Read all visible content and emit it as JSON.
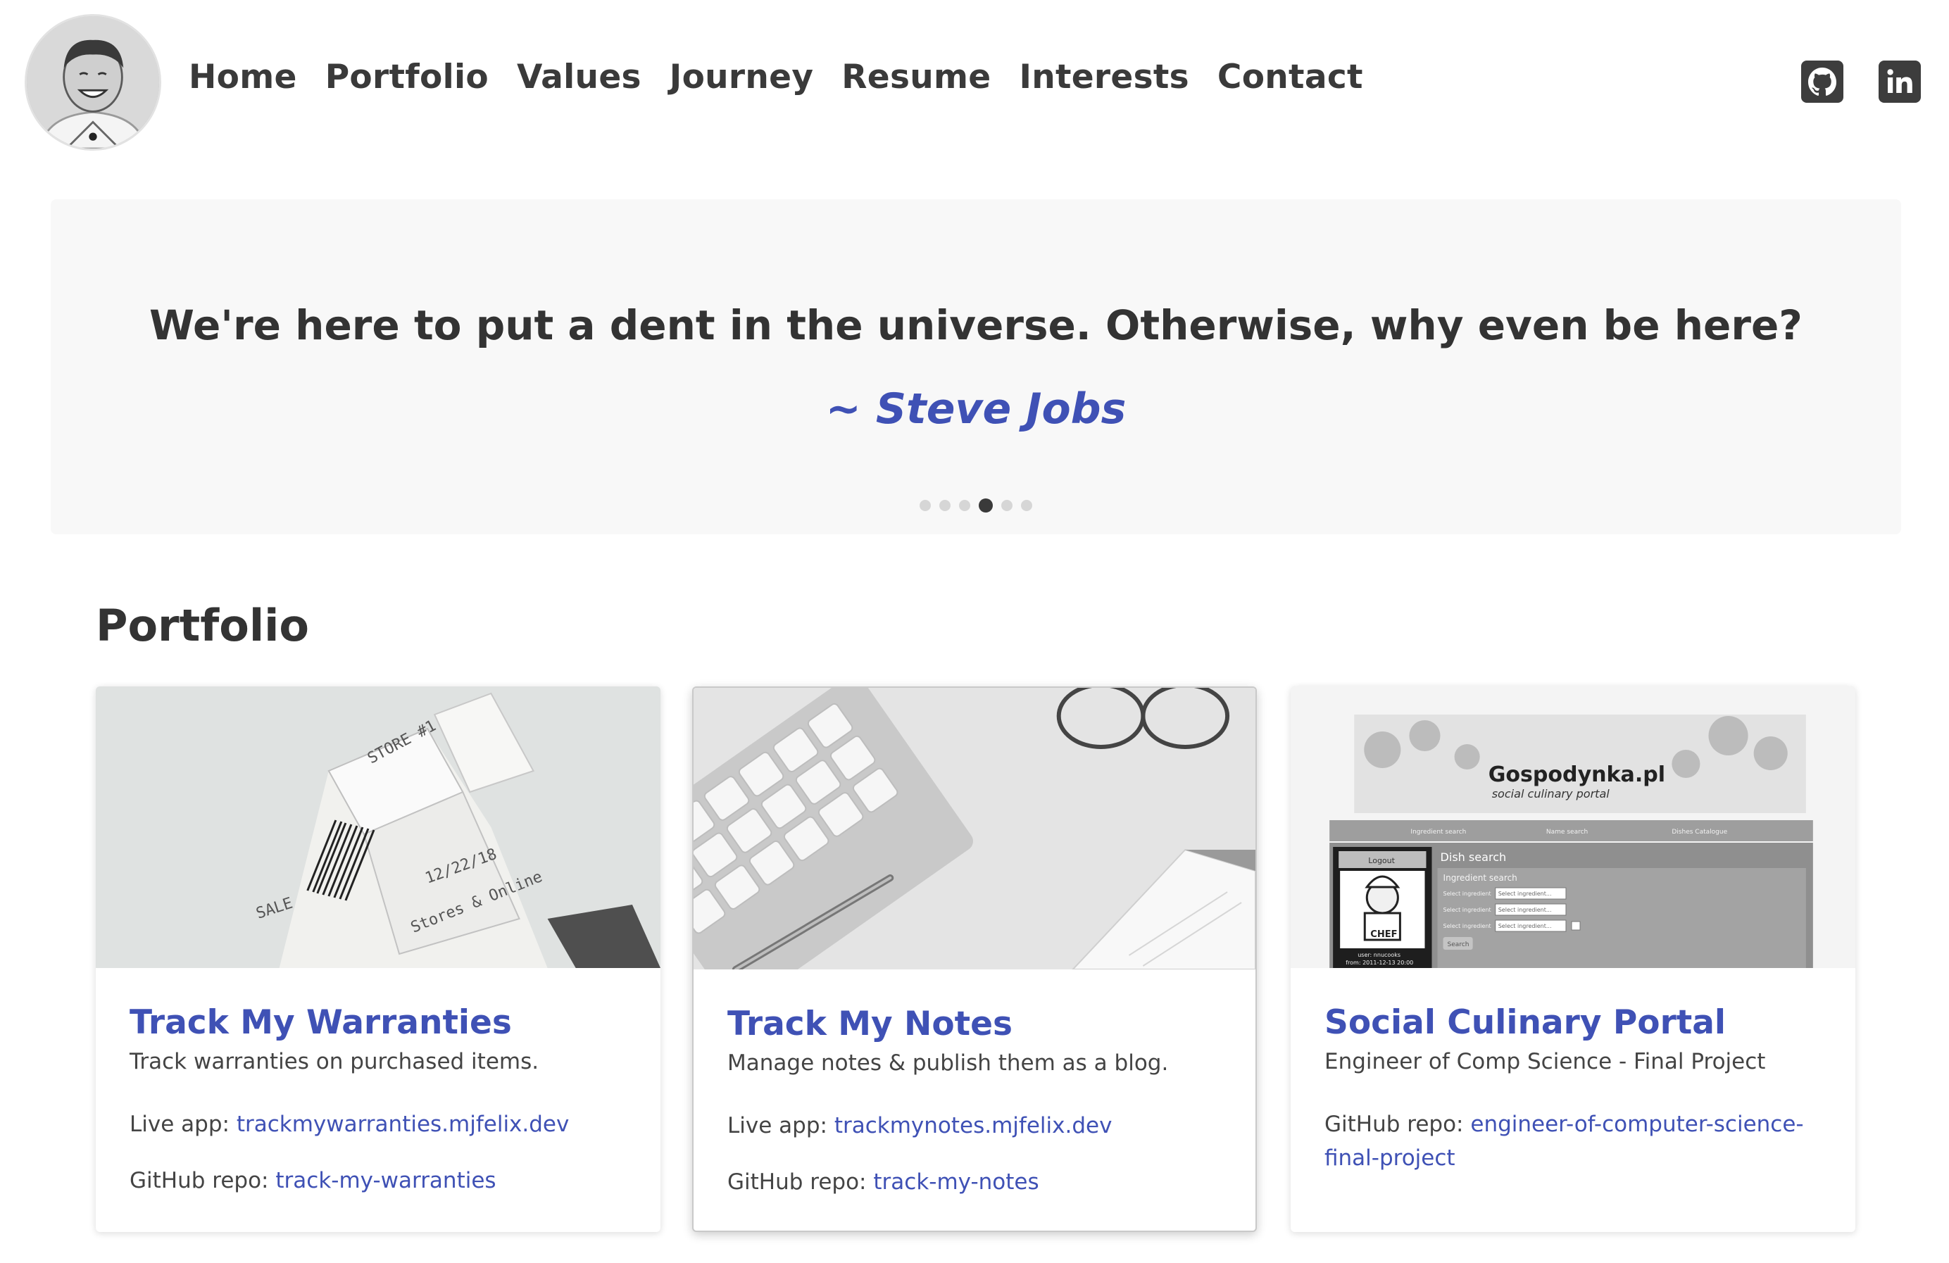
{
  "header": {
    "avatar_alt": "Profile photo",
    "nav": [
      "Home",
      "Portfolio",
      "Values",
      "Journey",
      "Resume",
      "Interests",
      "Contact"
    ],
    "social": [
      {
        "name": "github",
        "icon": "github-icon"
      },
      {
        "name": "linkedin",
        "icon": "linkedin-icon"
      }
    ]
  },
  "quote": {
    "text": "We're here to put a dent in the universe. Otherwise, why even be here?",
    "author": "~ Steve Jobs",
    "dots_total": 6,
    "active_index": 3
  },
  "portfolio": {
    "title": "Portfolio",
    "cards": [
      {
        "title": "Track My Warranties",
        "description": "Track warranties on purchased items.",
        "live_label": "Live app:",
        "live_link": "trackmywarranties.mjfelix.dev",
        "repo_label": "GitHub repo:",
        "repo_link": "track-my-warranties",
        "image_icon": "receipt-image"
      },
      {
        "title": "Track My Notes",
        "description": "Manage notes & publish them as a blog.",
        "live_label": "Live app:",
        "live_link": "trackmynotes.mjfelix.dev",
        "repo_label": "GitHub repo:",
        "repo_link": "track-my-notes",
        "image_icon": "keyboard-desk-image"
      },
      {
        "title": "Social Culinary Portal",
        "description": "Engineer of Comp Science - Final Project",
        "repo_label": "GitHub repo:",
        "repo_link": "engineer-of-computer-science-final-project",
        "image_icon": "website-screenshot-image",
        "screenshot": {
          "site_title": "Gospodynka.pl",
          "site_subtitle": "social culinary portal",
          "tabs": [
            "Ingredient search",
            "Name search",
            "Dishes Catalogue"
          ],
          "logout": "Logout",
          "panel_title": "Dish search",
          "panel_subtitle": "Ingredient search",
          "row_label": "Select ingredient",
          "select_placeholder": "Select ingredient...",
          "search_button": "Search",
          "chef_label": "CHEF",
          "user_label": "user: nnucooks",
          "user_date": "from: 2011-12-13 20:00"
        }
      }
    ]
  },
  "colors": {
    "accent": "#3f51b5",
    "text": "#333333",
    "quote_bg": "#f8f8f8"
  }
}
